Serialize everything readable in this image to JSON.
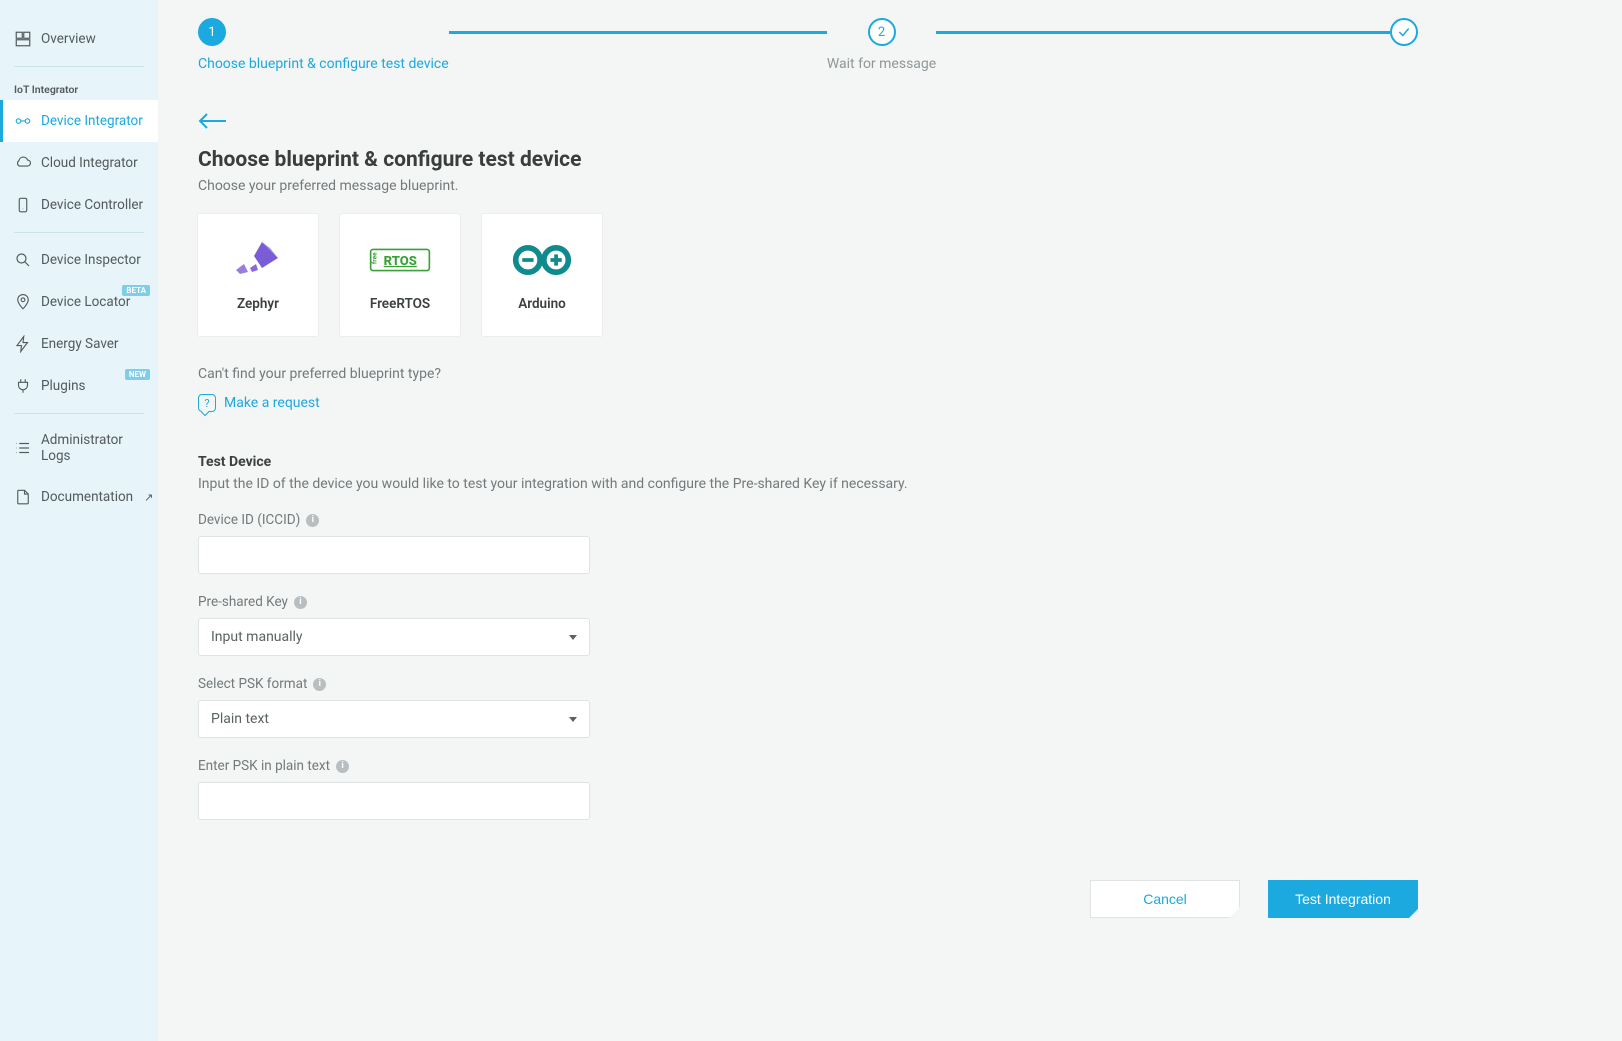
{
  "sidebar": {
    "overview": "Overview",
    "section_title": "IoT Integrator",
    "items": {
      "device_integrator": "Device Integrator",
      "cloud_integrator": "Cloud Integrator",
      "device_controller": "Device Controller",
      "device_inspector": "Device Inspector",
      "device_locator": "Device Locator",
      "device_locator_badge": "BETA",
      "energy_saver": "Energy Saver",
      "plugins": "Plugins",
      "plugins_badge": "NEW",
      "admin_logs": "Administrator Logs",
      "documentation": "Documentation"
    }
  },
  "stepper": {
    "step1_num": "1",
    "step1_label": "Choose blueprint & configure test device",
    "step2_num": "2",
    "step2_label": "Wait for message"
  },
  "page": {
    "title": "Choose blueprint & configure test device",
    "subtitle": "Choose your preferred message blueprint."
  },
  "blueprints": {
    "zephyr": "Zephyr",
    "freertos": "FreeRTOS",
    "arduino": "Arduino"
  },
  "request": {
    "hint": "Can't find your preferred blueprint type?",
    "link": "Make a request"
  },
  "test_device": {
    "title": "Test Device",
    "desc": "Input the ID of the device you would like to test your integration with and configure the Pre-shared Key if necessary.",
    "device_id_label": "Device ID (ICCID)",
    "psk_label": "Pre-shared Key",
    "psk_value": "Input manually",
    "psk_format_label": "Select PSK format",
    "psk_format_value": "Plain text",
    "psk_plain_label": "Enter PSK in plain text"
  },
  "actions": {
    "cancel": "Cancel",
    "test": "Test Integration"
  },
  "info_char": "i"
}
